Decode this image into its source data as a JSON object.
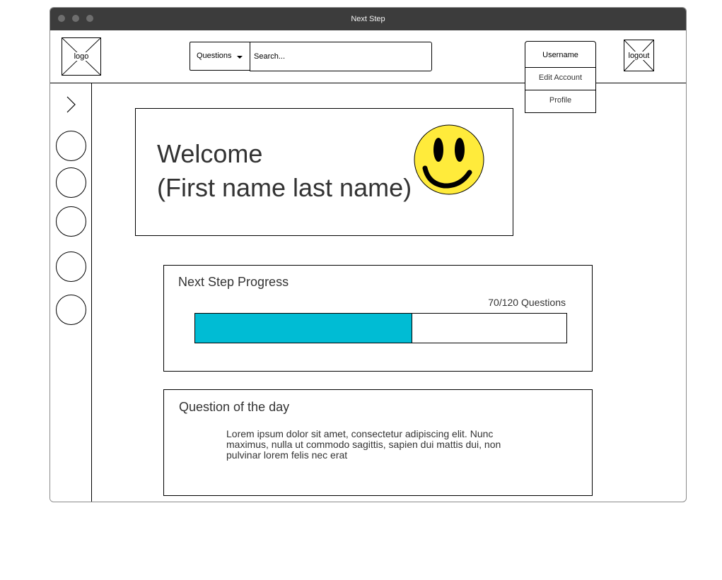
{
  "window": {
    "title": "Next Step"
  },
  "header": {
    "logo_label": "logo",
    "questions_dropdown": "Questions",
    "search_placeholder": "Search...",
    "logout_label": "logout"
  },
  "user_menu": {
    "username": "Username",
    "items": [
      "Edit Account",
      "Profile"
    ]
  },
  "sidebar": {
    "expand_icon": "chevron-right-icon",
    "nav_icon_count": 5
  },
  "welcome": {
    "line1": "Welcome",
    "line2": "(First name last name)",
    "avatar_icon": "smiley-icon"
  },
  "progress": {
    "title": "Next Step Progress",
    "count_text": "70/120 Questions",
    "completed": 70,
    "total": 120,
    "fill_color": "#00bcd4"
  },
  "question_of_day": {
    "title": "Question of the day",
    "text": "Lorem ipsum dolor sit amet, consectetur adipiscing elit. Nunc maximus, nulla ut commodo sagittis, sapien dui mattis dui, non pulvinar lorem felis nec erat"
  },
  "colors": {
    "titlebar": "#3c3c3c",
    "progress_fill": "#00bcd4",
    "smiley": "#ffeb3b"
  }
}
